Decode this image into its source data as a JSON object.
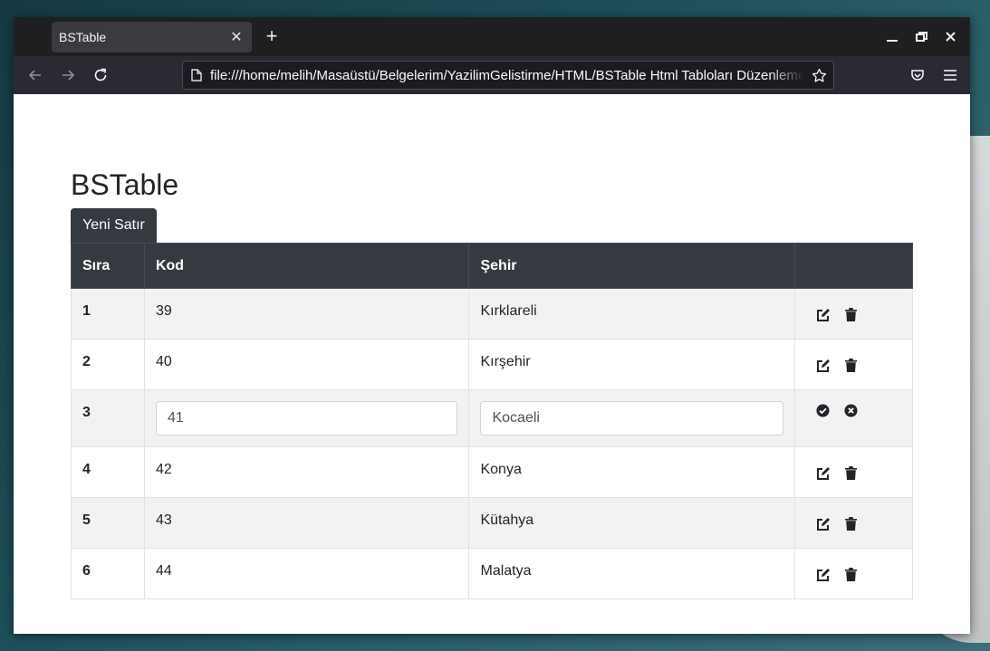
{
  "browser": {
    "tab_title": "BSTable",
    "close_tab_symbol": "✕",
    "new_tab_symbol": "+",
    "url": "file:///home/melih/Masaüstü/Belgelerim/YazilimGelistirme/HTML/BSTable Html Tabloları Düzenleme"
  },
  "page": {
    "title": "BSTable",
    "new_row_label": "Yeni Satır"
  },
  "table": {
    "headers": {
      "sira": "Sıra",
      "kod": "Kod",
      "sehir": "Şehir",
      "actions": ""
    },
    "rows": [
      {
        "sira": "1",
        "kod": "39",
        "sehir": "Kırklareli"
      },
      {
        "sira": "2",
        "kod": "40",
        "sehir": "Kırşehir"
      },
      {
        "sira": "3",
        "kod": "41",
        "sehir": "Kocaeli"
      },
      {
        "sira": "4",
        "kod": "42",
        "sehir": "Konya"
      },
      {
        "sira": "5",
        "kod": "43",
        "sehir": "Kütahya"
      },
      {
        "sira": "6",
        "kod": "44",
        "sehir": "Malatya"
      }
    ]
  },
  "icons": {
    "row_actions": [
      "edit-icon",
      "trash-icon"
    ],
    "editing_actions": [
      "check-circle-icon",
      "times-circle-icon"
    ]
  },
  "colors": {
    "table_header": "#343a40",
    "striped_row": "#f2f2f2"
  }
}
